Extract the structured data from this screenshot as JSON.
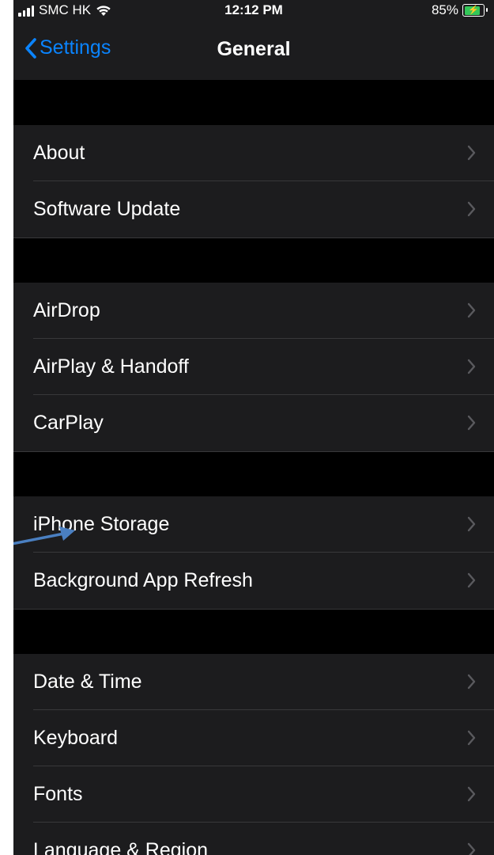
{
  "status_bar": {
    "carrier": "SMC HK",
    "time": "12:12 PM",
    "battery_percent": "85%",
    "battery_level": 0.85,
    "icons": [
      "signal-icon",
      "wifi-icon",
      "battery-icon",
      "charging-bolt-icon"
    ]
  },
  "nav": {
    "back_label": "Settings",
    "title": "General",
    "back_icon": "chevron-left-icon"
  },
  "groups": [
    {
      "items": [
        {
          "label": "About"
        },
        {
          "label": "Software Update"
        }
      ]
    },
    {
      "items": [
        {
          "label": "AirDrop"
        },
        {
          "label": "AirPlay & Handoff"
        },
        {
          "label": "CarPlay"
        }
      ]
    },
    {
      "items": [
        {
          "label": "iPhone Storage"
        },
        {
          "label": "Background App Refresh"
        }
      ]
    },
    {
      "items": [
        {
          "label": "Date & Time"
        },
        {
          "label": "Keyboard"
        },
        {
          "label": "Fonts"
        },
        {
          "label": "Language & Region"
        }
      ]
    }
  ],
  "colors": {
    "accent": "#0a84ff",
    "cell_background": "#1c1c1e",
    "page_background": "#000000",
    "separator": "#38383a",
    "chevron": "#5a5a5e",
    "annotation_arrow": "#4a7fc1",
    "battery_fill": "#34c759"
  },
  "annotation": {
    "icon": "pointer-arrow-icon",
    "target": "iPhone Storage"
  }
}
